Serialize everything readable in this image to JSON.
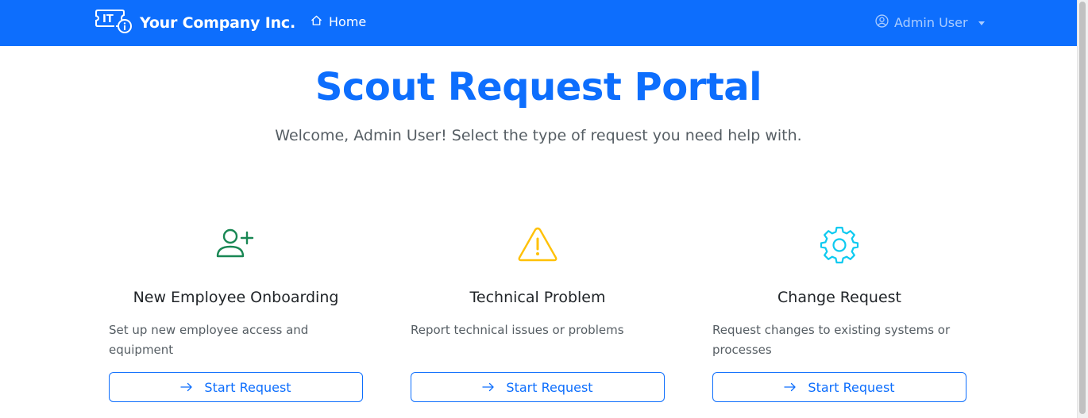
{
  "navbar": {
    "brand_logo_text": "IT",
    "brand_name": "Your Company Inc.",
    "home_label": "Home",
    "user_label": "Admin User"
  },
  "main": {
    "title": "Scout Request Portal",
    "subtitle": "Welcome, Admin User! Select the type of request you need help with."
  },
  "cards": [
    {
      "icon": "person-plus-icon",
      "color": "#198754",
      "title": "New Employee Onboarding",
      "description": "Set up new employee access and equipment",
      "button_label": "Start Request"
    },
    {
      "icon": "warning-triangle-icon",
      "color": "#ffc107",
      "title": "Technical Problem",
      "description": "Report technical issues or problems",
      "button_label": "Start Request"
    },
    {
      "icon": "gear-icon",
      "color": "#0dcaf0",
      "title": "Change Request",
      "description": "Request changes to existing systems or processes",
      "button_label": "Start Request"
    }
  ],
  "colors": {
    "primary": "#0d6efd",
    "navbar_bg": "#0d6efd"
  }
}
